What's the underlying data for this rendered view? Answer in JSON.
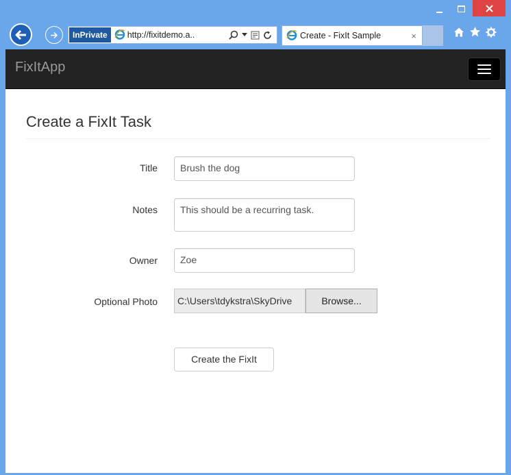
{
  "browser": {
    "inprivate_label": "InPrivate",
    "address_url": "http://fixitdemo.a..",
    "tab_title": "Create - FixIt Sample",
    "tab_close": "×"
  },
  "app": {
    "brand": "FixItApp"
  },
  "page": {
    "title": "Create a FixIt Task"
  },
  "form": {
    "title_label": "Title",
    "title_value": "Brush the dog",
    "notes_label": "Notes",
    "notes_value": "This should be a recurring task.",
    "owner_label": "Owner",
    "owner_value": "Zoe",
    "photo_label": "Optional Photo",
    "photo_path": "C:\\Users\\tdykstra\\SkyDrive",
    "browse_label": "Browse...",
    "submit_label": "Create the FixIt"
  },
  "colors": {
    "window_frame": "#6aa6ea",
    "navbar": "#222222",
    "close_button": "#e04343"
  }
}
